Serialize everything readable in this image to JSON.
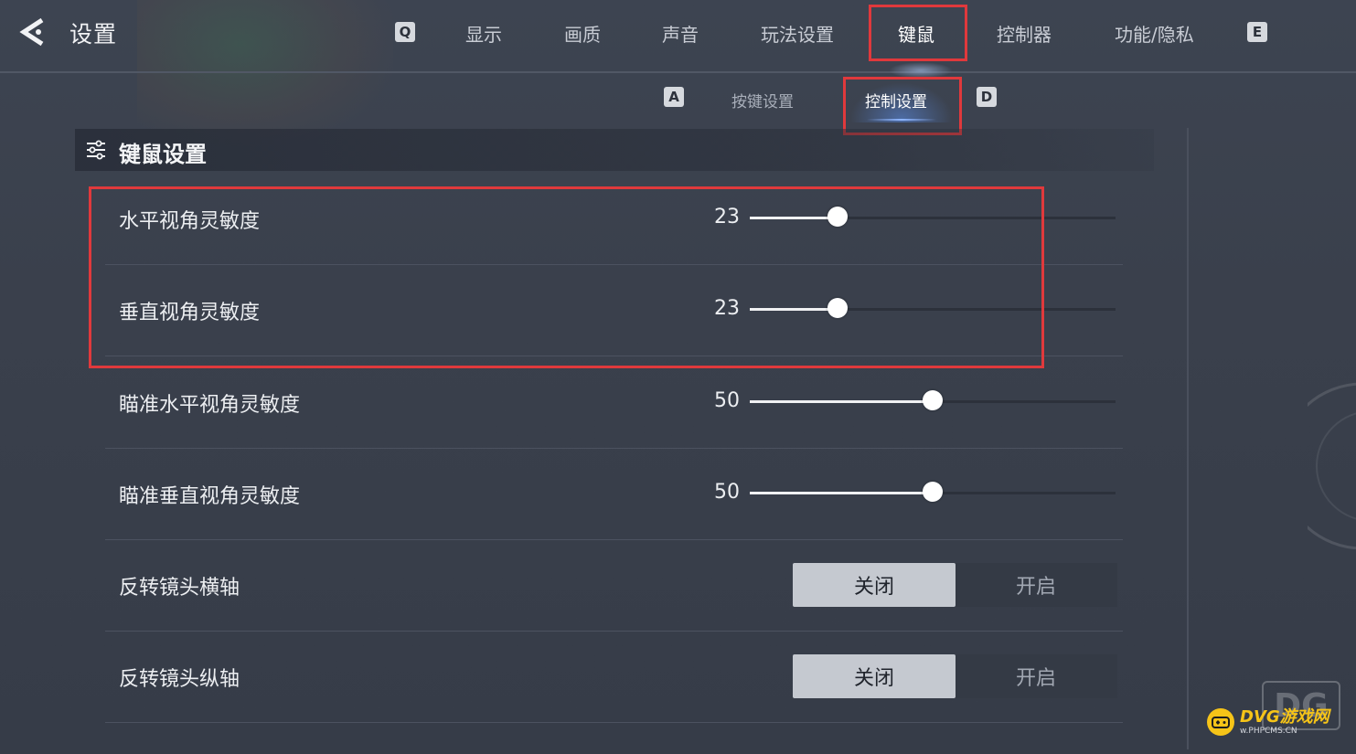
{
  "header": {
    "title": "设置",
    "left_key": "Q",
    "right_key": "E",
    "tabs": [
      {
        "label": "显示"
      },
      {
        "label": "画质"
      },
      {
        "label": "声音"
      },
      {
        "label": "玩法设置"
      },
      {
        "label": "键鼠"
      },
      {
        "label": "控制器"
      },
      {
        "label": "功能/隐私"
      }
    ],
    "active_tab": "键鼠"
  },
  "subtabs": {
    "left_key": "A",
    "right_key": "D",
    "items": [
      {
        "label": "按键设置"
      },
      {
        "label": "控制设置"
      }
    ],
    "active": "控制设置"
  },
  "section": {
    "title": "键鼠设置",
    "icon": "sliders-icon"
  },
  "settings": {
    "horizontal_sensitivity": {
      "label": "水平视角灵敏度",
      "value": "23",
      "fraction": 0.24
    },
    "vertical_sensitivity": {
      "label": "垂直视角灵敏度",
      "value": "23",
      "fraction": 0.24
    },
    "aim_horizontal_sensitivity": {
      "label": "瞄准水平视角灵敏度",
      "value": "50",
      "fraction": 0.5
    },
    "aim_vertical_sensitivity": {
      "label": "瞄准垂直视角灵敏度",
      "value": "50",
      "fraction": 0.5
    },
    "invert_x": {
      "label": "反转镜头横轴",
      "off_label": "关闭",
      "on_label": "开启",
      "selected": "关闭"
    },
    "invert_y": {
      "label": "反转镜头纵轴",
      "off_label": "关闭",
      "on_label": "开启",
      "selected": "关闭"
    }
  },
  "watermark": {
    "main": "DVG游戏网",
    "sub": "w.PHPCMS.CN",
    "ghost": "DG"
  },
  "colors": {
    "highlight": "#e0393c",
    "accent": "#8fb6ff",
    "watermark": "#f6c418"
  }
}
